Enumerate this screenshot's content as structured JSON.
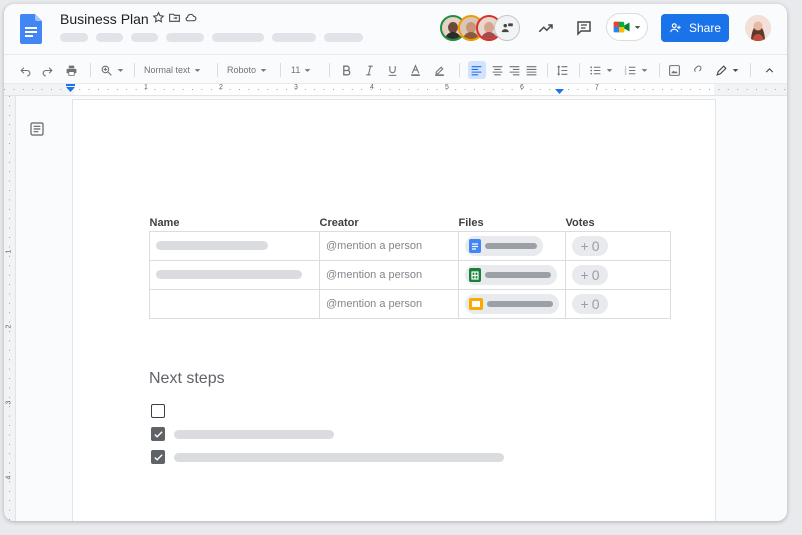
{
  "header": {
    "doc_title": "Business Plan",
    "share_label": "Share",
    "menu_placeholder_count": 9
  },
  "toolbar": {
    "style_label": "Normal text",
    "font_label": "Roboto",
    "font_size": "11"
  },
  "ruler": {
    "marks": [
      "1",
      "2",
      "3",
      "4",
      "5",
      "6",
      "7"
    ],
    "vmarks": [
      "1",
      "2",
      "3",
      "4"
    ]
  },
  "table": {
    "headers": [
      "Name",
      "Creator",
      "Files",
      "Votes"
    ],
    "rows": [
      {
        "creator_placeholder": "@mention a person",
        "file_type": "doc",
        "votes": "0"
      },
      {
        "creator_placeholder": "@mention a person",
        "file_type": "sheet",
        "votes": "0"
      },
      {
        "creator_placeholder": "@mention a person",
        "file_type": "slide",
        "votes": "0"
      }
    ]
  },
  "next_steps": {
    "heading": "Next steps",
    "items": [
      {
        "checked": false
      },
      {
        "checked": true
      },
      {
        "checked": true
      }
    ]
  },
  "colors": {
    "accent": "#1a73e8",
    "doc_icon": "#4285f4",
    "sheet_icon": "#188038",
    "slide_icon": "#f9ab00"
  },
  "icons": [
    "docs-logo-icon",
    "star-icon",
    "move-to-folder-icon",
    "cloud-saved-icon",
    "trending-icon",
    "comments-icon",
    "meet-icon",
    "share-people-icon",
    "undo-icon",
    "redo-icon",
    "print-icon",
    "zoom-icon",
    "bold-icon",
    "italic-icon",
    "underline-icon",
    "text-color-icon",
    "highlight-icon",
    "align-left-icon",
    "align-center-icon",
    "align-right-icon",
    "justify-icon",
    "line-spacing-icon",
    "bulleted-list-icon",
    "numbered-list-icon",
    "insert-image-icon",
    "edit-mode-icon",
    "collapse-icon",
    "outline-icon"
  ]
}
